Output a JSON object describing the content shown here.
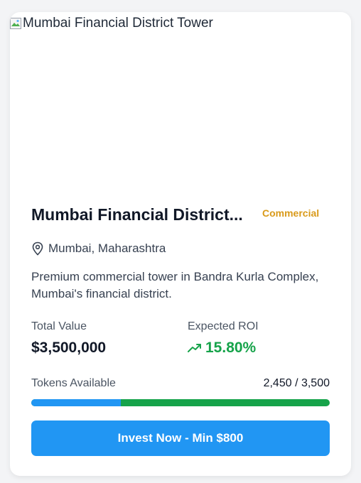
{
  "property": {
    "image_alt": "Mumbai Financial District Tower",
    "title": "Mumbai Financial District...",
    "category": "Commercial",
    "location": "Mumbai, Maharashtra",
    "description": "Premium commercial tower in Bandra Kurla Complex, Mumbai's financial district."
  },
  "stats": {
    "total_value_label": "Total Value",
    "total_value": "$3,500,000",
    "roi_label": "Expected ROI",
    "roi_value": "15.80%"
  },
  "tokens": {
    "label": "Tokens Available",
    "count": "2,450 / 3,500",
    "available_fraction": 0.3
  },
  "cta": {
    "label": "Invest Now - Min $800"
  },
  "colors": {
    "primary": "#2196f3",
    "success": "#16a34a",
    "badge": "#d99a1a"
  },
  "icons": {
    "location": "map-pin-icon",
    "roi": "trending-up-icon",
    "image": "broken-image-icon"
  }
}
